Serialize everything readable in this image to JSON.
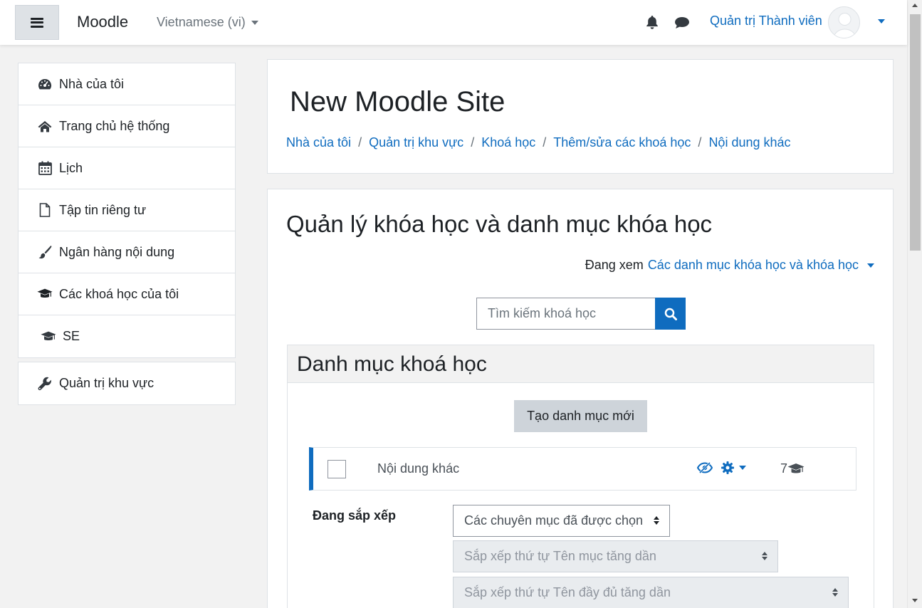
{
  "navbar": {
    "brand": "Moodle",
    "language": "Vietnamese (vi)",
    "user_name": "Quản trị Thành viên"
  },
  "drawer": {
    "items": [
      {
        "label": "Nhà của tôi",
        "icon": "dashboard-icon"
      },
      {
        "label": "Trang chủ hệ thống",
        "icon": "home-icon"
      },
      {
        "label": "Lịch",
        "icon": "calendar-icon"
      },
      {
        "label": "Tập tin riêng tư",
        "icon": "file-icon"
      },
      {
        "label": "Ngân hàng nội dung",
        "icon": "paintbrush-icon"
      },
      {
        "label": "Các khoá học của tôi",
        "icon": "graduation-cap-icon"
      },
      {
        "label": "SE",
        "icon": "graduation-cap-icon"
      }
    ],
    "admin": {
      "label": "Quản trị khu vực",
      "icon": "wrench-icon"
    }
  },
  "header": {
    "site_title": "New Moodle Site",
    "breadcrumb": [
      "Nhà của tôi",
      "Quản trị khu vực",
      "Khoá học",
      "Thêm/sửa các khoá học",
      "Nội dung khác"
    ],
    "separator": "/"
  },
  "main": {
    "heading": "Quản lý khóa học và danh mục khóa học",
    "viewing_label": "Đang xem",
    "viewing_value": "Các danh mục khóa học và khóa học",
    "search_placeholder": "Tìm kiếm khoá học",
    "category_panel": {
      "title": "Danh mục khoá học",
      "new_button": "Tạo danh mục mới",
      "categories": [
        {
          "name": "Nội dung khác",
          "course_count": "7"
        }
      ]
    },
    "sort": {
      "label": "Đang sắp xếp",
      "scope_select": "Các chuyên mục đã được chọn",
      "category_sort_select": "Sắp xếp thứ tự Tên mục tăng dần",
      "course_sort_select": "Sắp xếp thứ tự Tên đầy đủ tăng dần"
    }
  },
  "colors": {
    "primary": "#0f6cbf",
    "text": "#1d2125",
    "page_bg": "#f2f2f2",
    "border": "#dee2e6"
  }
}
